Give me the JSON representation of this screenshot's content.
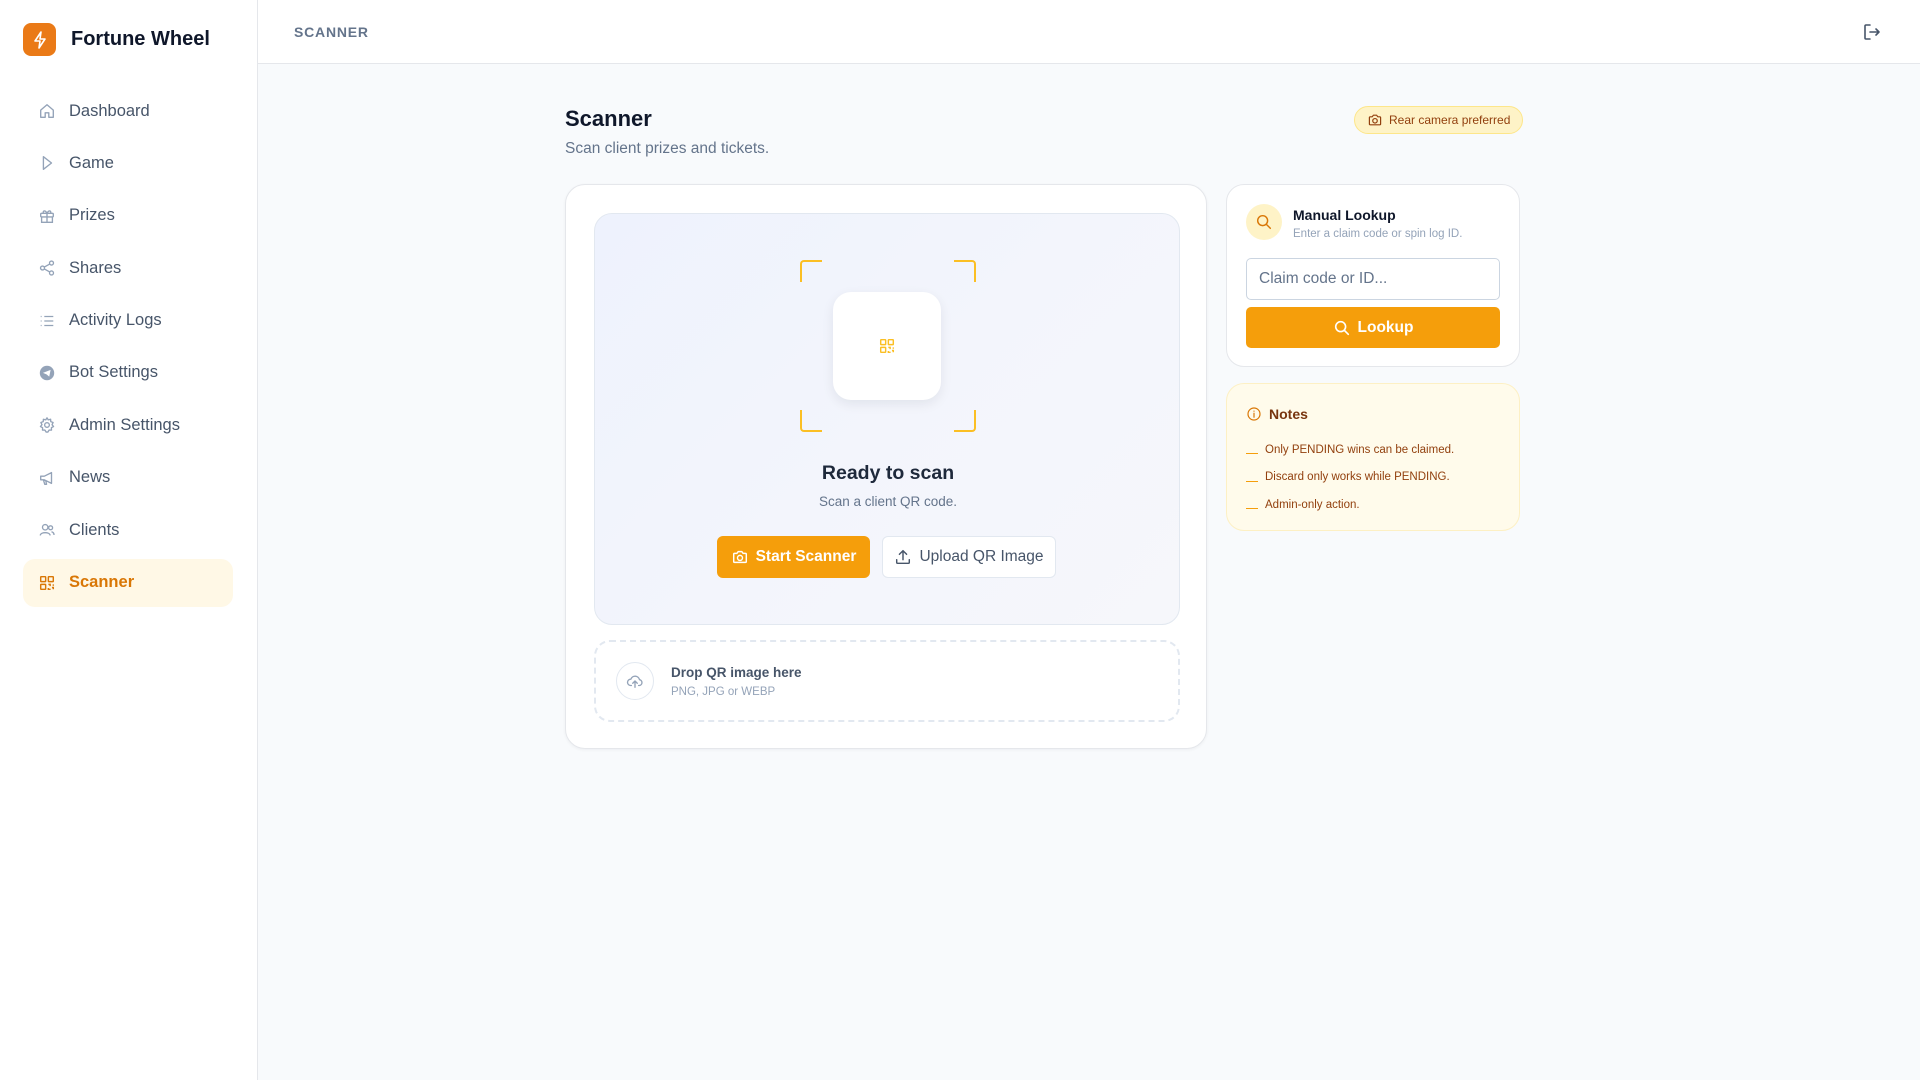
{
  "brand": {
    "name": "Fortune Wheel",
    "logo_icon": "bolt-icon",
    "accent": "#ea7a17"
  },
  "sidebar": {
    "items": [
      {
        "label": "Dashboard",
        "icon": "home-icon",
        "active": false
      },
      {
        "label": "Game",
        "icon": "play-icon",
        "active": false
      },
      {
        "label": "Prizes",
        "icon": "gift-icon",
        "active": false
      },
      {
        "label": "Shares",
        "icon": "share-icon",
        "active": false
      },
      {
        "label": "Activity Logs",
        "icon": "list-icon",
        "active": false
      },
      {
        "label": "Bot Settings",
        "icon": "telegram-icon",
        "active": false
      },
      {
        "label": "Admin Settings",
        "icon": "gear-icon",
        "active": false
      },
      {
        "label": "News",
        "icon": "megaphone-icon",
        "active": false
      },
      {
        "label": "Clients",
        "icon": "users-icon",
        "active": false
      },
      {
        "label": "Scanner",
        "icon": "qr-icon",
        "active": true
      }
    ]
  },
  "topbar": {
    "breadcrumb": "SCANNER",
    "logout_icon": "logout-icon"
  },
  "page": {
    "title": "Scanner",
    "subtitle": "Scan client prizes and tickets.",
    "badge": "Rear camera preferred"
  },
  "scanner": {
    "ready_title": "Ready to scan",
    "ready_subtitle": "Scan a client QR code.",
    "start_label": "Start Scanner",
    "upload_label": "Upload QR Image",
    "drop_title": "Drop QR image here",
    "drop_subtitle": "PNG, JPG or WEBP"
  },
  "lookup": {
    "title": "Manual Lookup",
    "subtitle": "Enter a claim code or spin log ID.",
    "input_placeholder": "Claim code or ID...",
    "input_value": "",
    "button_label": "Lookup"
  },
  "notes": {
    "title": "Notes",
    "items": [
      "Only PENDING wins can be claimed.",
      "Discard only works while PENDING.",
      "Admin-only action."
    ]
  },
  "colors": {
    "primary": "#f59e0b",
    "active_bg": "#fff8e6",
    "active_text": "#d97706"
  }
}
